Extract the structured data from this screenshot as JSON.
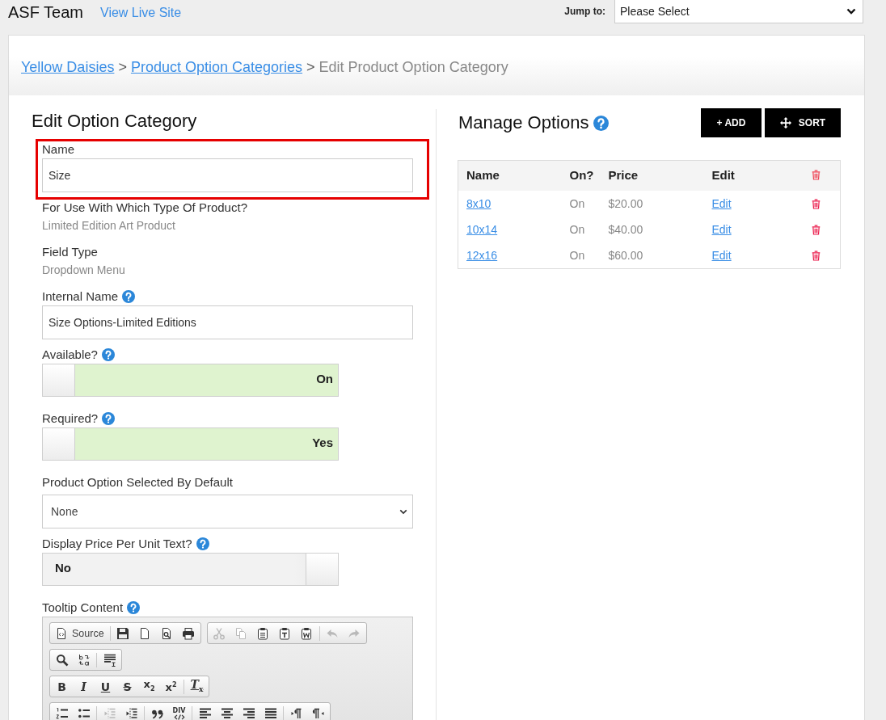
{
  "top_bar": {
    "brand": "ASF Team",
    "live_site_link": "View Live Site",
    "jump_label": "Jump to:",
    "jump_select": "Please Select"
  },
  "breadcrumb": [
    {
      "kind": "link",
      "text": "Yellow Daisies"
    },
    {
      "kind": "separator",
      "text": ">"
    },
    {
      "kind": "link",
      "text": "Product Option Categories"
    },
    {
      "kind": "separator",
      "text": ">"
    },
    {
      "kind": "current",
      "text": "Edit Product Option Category"
    }
  ],
  "form": {
    "title": "Edit Option Category",
    "fields": [
      {
        "kind": "text",
        "label": "Name",
        "help": false,
        "highlighted": true,
        "value": "Size"
      },
      {
        "kind": "static",
        "label": "For Use With Which Type Of Product?",
        "help": false,
        "highlighted": false,
        "value": "Limited Edition Art Product"
      },
      {
        "kind": "static",
        "label": "Field Type",
        "help": false,
        "highlighted": false,
        "value": "Dropdown Menu"
      },
      {
        "kind": "text",
        "label": "Internal Name",
        "help": true,
        "highlighted": false,
        "value": "Size Options-Limited Editions"
      },
      {
        "kind": "toggle",
        "label": "Available?",
        "help": true,
        "highlighted": false,
        "on": true,
        "text": "On"
      },
      {
        "kind": "toggle",
        "label": "Required?",
        "help": true,
        "highlighted": false,
        "on": true,
        "text": "Yes"
      },
      {
        "kind": "select",
        "label": "Product Option Selected By Default",
        "help": false,
        "highlighted": false,
        "value": "None"
      },
      {
        "kind": "toggle",
        "label": "Display Price Per Unit Text?",
        "help": true,
        "highlighted": false,
        "on": false,
        "text": "No"
      },
      {
        "kind": "editor",
        "label": "Tooltip Content",
        "help": true,
        "highlighted": false,
        "toolbar": [
          {
            "groups": [
              {
                "sections": [
                  {
                    "buttons": [
                      {
                        "kind": "source",
                        "label": "Source",
                        "disabled": false
                      }
                    ]
                  },
                  {
                    "buttons": [
                      {
                        "kind": "save",
                        "disabled": false
                      },
                      {
                        "kind": "newpage",
                        "disabled": false
                      },
                      {
                        "kind": "preview",
                        "disabled": false
                      },
                      {
                        "kind": "print",
                        "disabled": false
                      }
                    ]
                  }
                ]
              },
              {
                "sections": [
                  {
                    "buttons": [
                      {
                        "kind": "cut",
                        "disabled": true
                      },
                      {
                        "kind": "copy",
                        "disabled": true
                      },
                      {
                        "kind": "paste",
                        "disabled": false
                      },
                      {
                        "kind": "pastetext",
                        "disabled": false
                      },
                      {
                        "kind": "pasteword",
                        "disabled": false
                      }
                    ]
                  },
                  {
                    "buttons": [
                      {
                        "kind": "undo",
                        "disabled": true
                      },
                      {
                        "kind": "redo",
                        "disabled": true
                      }
                    ]
                  }
                ]
              }
            ]
          },
          {
            "groups": [
              {
                "sections": [
                  {
                    "buttons": [
                      {
                        "kind": "find",
                        "disabled": false
                      },
                      {
                        "kind": "replace",
                        "disabled": false
                      }
                    ]
                  },
                  {
                    "buttons": [
                      {
                        "kind": "selectall",
                        "disabled": false
                      }
                    ]
                  }
                ]
              }
            ]
          },
          {
            "groups": [
              {
                "sections": [
                  {
                    "buttons": [
                      {
                        "kind": "bold",
                        "label": "B",
                        "disabled": false
                      },
                      {
                        "kind": "italic",
                        "label": "I",
                        "disabled": false
                      },
                      {
                        "kind": "underline",
                        "label": "U",
                        "disabled": false
                      },
                      {
                        "kind": "strike",
                        "label": "S",
                        "disabled": false
                      },
                      {
                        "kind": "subscript",
                        "label": "x$_{2}$",
                        "disabled": false
                      },
                      {
                        "kind": "superscript",
                        "label": "x$^{2}$",
                        "disabled": false
                      }
                    ]
                  },
                  {
                    "buttons": [
                      {
                        "kind": "removeformat",
                        "label": "T$_{x}$",
                        "disabled": false
                      }
                    ]
                  }
                ]
              }
            ]
          },
          {
            "groups": [
              {
                "sections": [
                  {
                    "buttons": [
                      {
                        "kind": "numlist",
                        "disabled": false
                      },
                      {
                        "kind": "bullist",
                        "disabled": false
                      }
                    ]
                  },
                  {
                    "buttons": [
                      {
                        "kind": "outdent",
                        "disabled": true
                      },
                      {
                        "kind": "indent",
                        "disabled": false
                      }
                    ]
                  },
                  {
                    "buttons": [
                      {
                        "kind": "blockquote",
                        "disabled": false
                      },
                      {
                        "kind": "creatediv",
                        "label": "DIV",
                        "disabled": false
                      }
                    ]
                  },
                  {
                    "buttons": [
                      {
                        "kind": "alignleft",
                        "disabled": false
                      },
                      {
                        "kind": "aligncenter",
                        "disabled": false
                      },
                      {
                        "kind": "alignright",
                        "disabled": false
                      },
                      {
                        "kind": "justify",
                        "disabled": false
                      }
                    ]
                  },
                  {
                    "buttons": [
                      {
                        "kind": "ltr",
                        "disabled": false
                      },
                      {
                        "kind": "rtl",
                        "disabled": false
                      }
                    ]
                  }
                ]
              }
            ]
          }
        ]
      }
    ]
  },
  "options": {
    "title": "Manage Options",
    "help": true,
    "buttons": [
      {
        "kind": "add",
        "label": "+ ADD"
      },
      {
        "kind": "sort",
        "label": "SORT"
      }
    ],
    "columns": [
      "Name",
      "On?",
      "Price",
      "Edit"
    ],
    "rows": [
      {
        "name": "8x10",
        "on": "On",
        "price": "$20.00",
        "edit": "Edit"
      },
      {
        "name": "10x14",
        "on": "On",
        "price": "$40.00",
        "edit": "Edit"
      },
      {
        "name": "12x16",
        "on": "On",
        "price": "$60.00",
        "edit": "Edit"
      }
    ]
  }
}
